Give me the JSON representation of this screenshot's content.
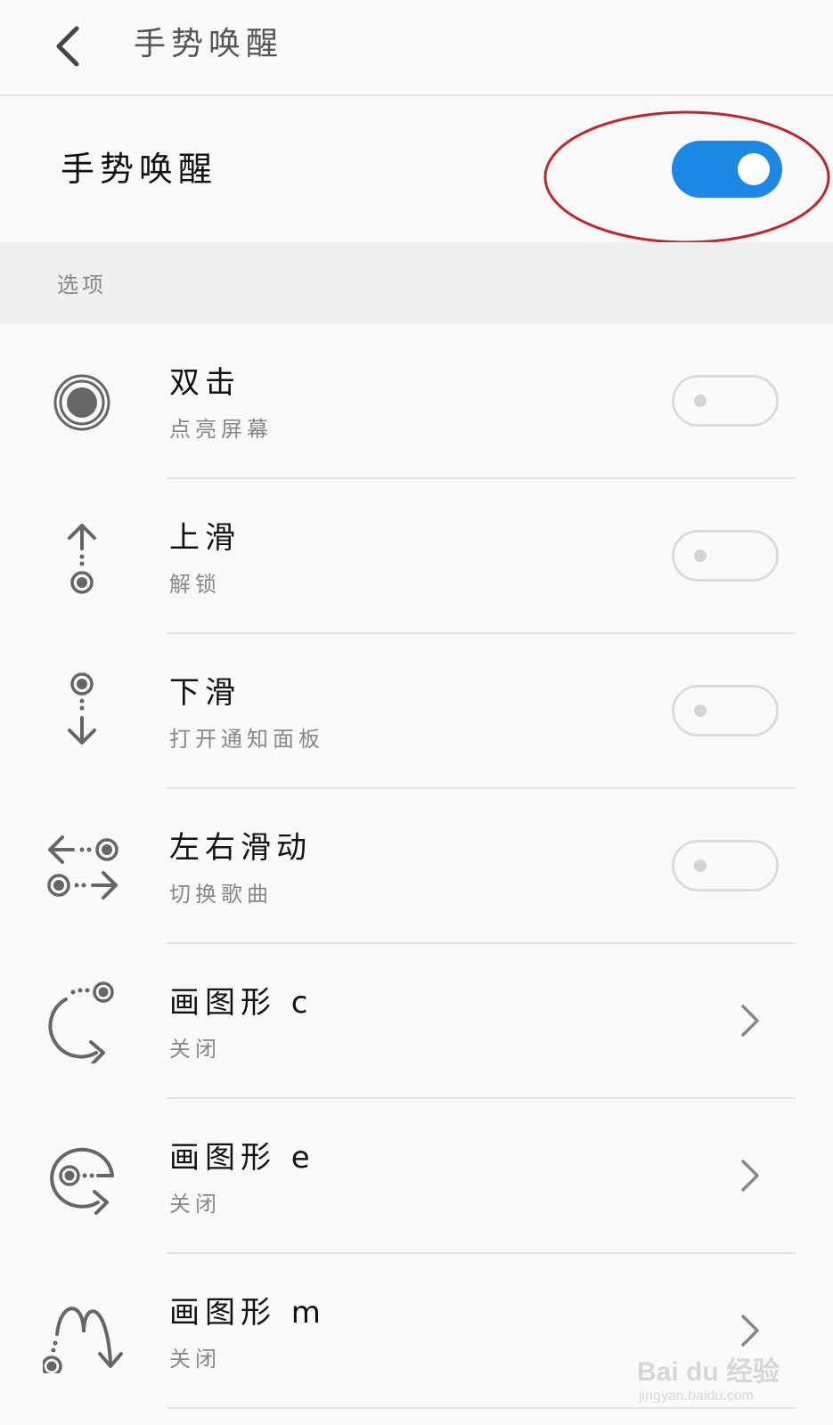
{
  "header": {
    "title": "手势唤醒"
  },
  "master": {
    "label": "手势唤醒",
    "enabled": true,
    "accent": "#1e88e5"
  },
  "section": {
    "label": "选项"
  },
  "items": [
    {
      "icon": "double-tap-icon",
      "title": "双击",
      "subtitle": "点亮屏幕",
      "control": "toggle",
      "enabled": false
    },
    {
      "icon": "swipe-up-icon",
      "title": "上滑",
      "subtitle": "解锁",
      "control": "toggle",
      "enabled": false
    },
    {
      "icon": "swipe-down-icon",
      "title": "下滑",
      "subtitle": "打开通知面板",
      "control": "toggle",
      "enabled": false
    },
    {
      "icon": "swipe-left-right-icon",
      "title": "左右滑动",
      "subtitle": "切换歌曲",
      "control": "toggle",
      "enabled": false
    },
    {
      "icon": "draw-c-icon",
      "title": "画图形 c",
      "subtitle": "关闭",
      "control": "chevron"
    },
    {
      "icon": "draw-e-icon",
      "title": "画图形 e",
      "subtitle": "关闭",
      "control": "chevron"
    },
    {
      "icon": "draw-m-icon",
      "title": "画图形 m",
      "subtitle": "关闭",
      "control": "chevron"
    }
  ],
  "watermark": {
    "brand": "Bai du 经验",
    "url": "jingyan.baidu.com"
  }
}
